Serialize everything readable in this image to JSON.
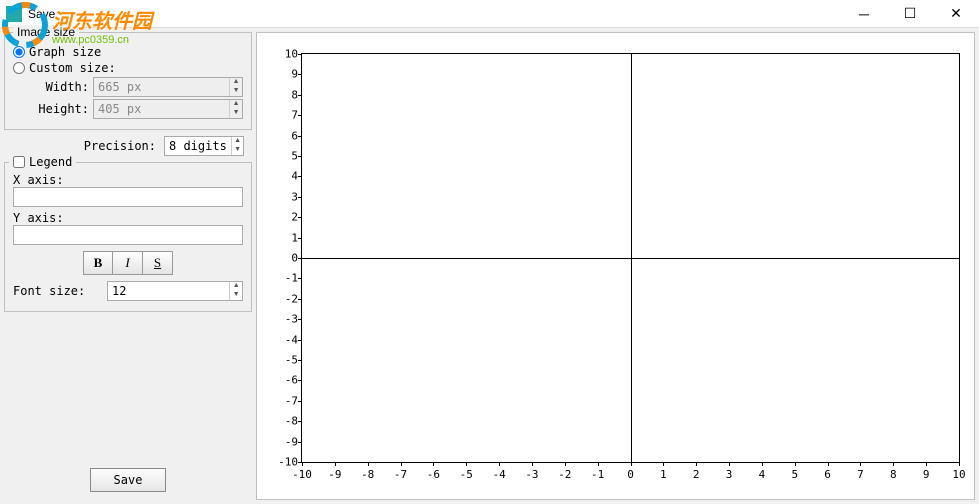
{
  "window": {
    "title": "Save"
  },
  "watermark": {
    "name": "河东软件园",
    "url": "www.pc0359.cn"
  },
  "image_size": {
    "legend": "Image size",
    "graph_size_label": "Graph size",
    "custom_size_label": "Custom size:",
    "width_label": "Width:",
    "width_value": "665 px",
    "height_label": "Height:",
    "height_value": "405 px"
  },
  "precision": {
    "label": "Precision:",
    "value": "8 digits"
  },
  "legend": {
    "checkbox_label": "Legend",
    "xaxis_label": "X axis:",
    "xaxis_value": "",
    "yaxis_label": "Y axis:",
    "yaxis_value": "",
    "bold": "B",
    "italic": "I",
    "underline": "S",
    "font_size_label": "Font size:",
    "font_size_value": "12"
  },
  "save_button": "Save",
  "chart_data": {
    "type": "cartesian-axes",
    "title": "",
    "xlabel": "",
    "ylabel": "",
    "xlim": [
      -10,
      10
    ],
    "ylim": [
      -10,
      10
    ],
    "xticks": [
      -10,
      -9,
      -8,
      -7,
      -6,
      -5,
      -4,
      -3,
      -2,
      -1,
      0,
      1,
      2,
      3,
      4,
      5,
      6,
      7,
      8,
      9,
      10
    ],
    "yticks": [
      -10,
      -9,
      -8,
      -7,
      -6,
      -5,
      -4,
      -3,
      -2,
      -1,
      0,
      1,
      2,
      3,
      4,
      5,
      6,
      7,
      8,
      9,
      10
    ],
    "series": []
  }
}
